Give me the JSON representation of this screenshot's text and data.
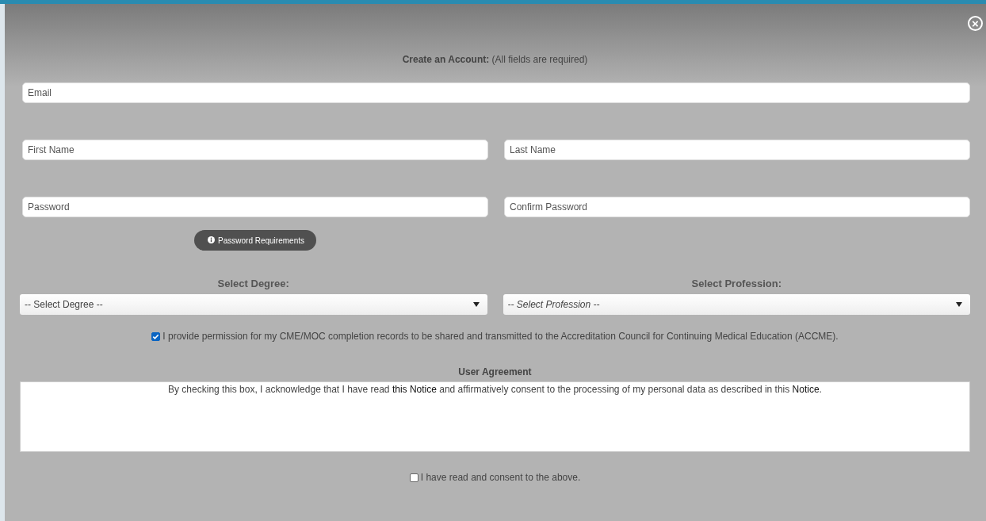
{
  "close_button": {
    "symbol": "×"
  },
  "heading": {
    "bold": "Create an Account:",
    "rest": "(All fields are required)"
  },
  "email": {
    "placeholder": "Email"
  },
  "first_name": {
    "placeholder": "First Name"
  },
  "last_name": {
    "placeholder": "Last Name"
  },
  "password": {
    "placeholder": "Password"
  },
  "confirm_password": {
    "placeholder": "Confirm Password"
  },
  "password_requirements_button": {
    "label": "Password Requirements"
  },
  "degree": {
    "label": "Select Degree:",
    "value": "-- Select Degree --",
    "italic": false
  },
  "profession": {
    "label": "Select Profession:",
    "value": "-- Select Profession --",
    "italic": true
  },
  "permission": {
    "checked": true,
    "label": "I provide permission for my CME/MOC completion records to be shared and transmitted to the Accreditation Council for Continuing Medical Education (ACCME)."
  },
  "user_agreement": {
    "title": "User Agreement",
    "parts": [
      {
        "kind": "text",
        "text": "By checking this box, I acknowledge that I have read "
      },
      {
        "kind": "link",
        "text": "this Notice"
      },
      {
        "kind": "text",
        "text": " and affirmatively consent to the processing of my personal data as described in this "
      },
      {
        "kind": "link",
        "text": "Notice"
      },
      {
        "kind": "text",
        "text": "."
      }
    ]
  },
  "consent": {
    "checked": false,
    "label": "I have read and consent to the above."
  }
}
